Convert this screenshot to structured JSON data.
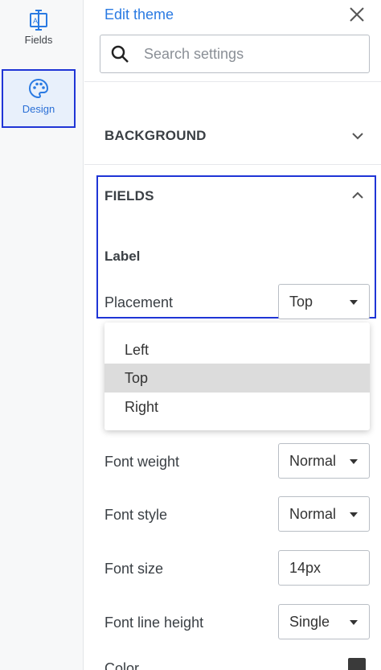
{
  "rail": {
    "fields_label": "Fields",
    "design_label": "Design"
  },
  "header": {
    "title": "Edit theme"
  },
  "search": {
    "placeholder": "Search settings"
  },
  "sections": {
    "background": "BACKGROUND",
    "fields": "FIELDS"
  },
  "label_group": {
    "heading": "Label",
    "placement_label": "Placement",
    "placement_value": "Top"
  },
  "placement_options": [
    "Left",
    "Top",
    "Right"
  ],
  "placement_selected": "Top",
  "settings": {
    "font_weight_label": "Font weight",
    "font_weight_value": "Normal",
    "font_style_label": "Font style",
    "font_style_value": "Normal",
    "font_size_label": "Font size",
    "font_size_value": "14px",
    "line_height_label": "Font line height",
    "line_height_value": "Single",
    "color_label": "Color"
  },
  "colors": {
    "accent": "#2a7ae2",
    "highlight_border": "#1f35d6",
    "color_swatch": "#3a3a3a"
  }
}
